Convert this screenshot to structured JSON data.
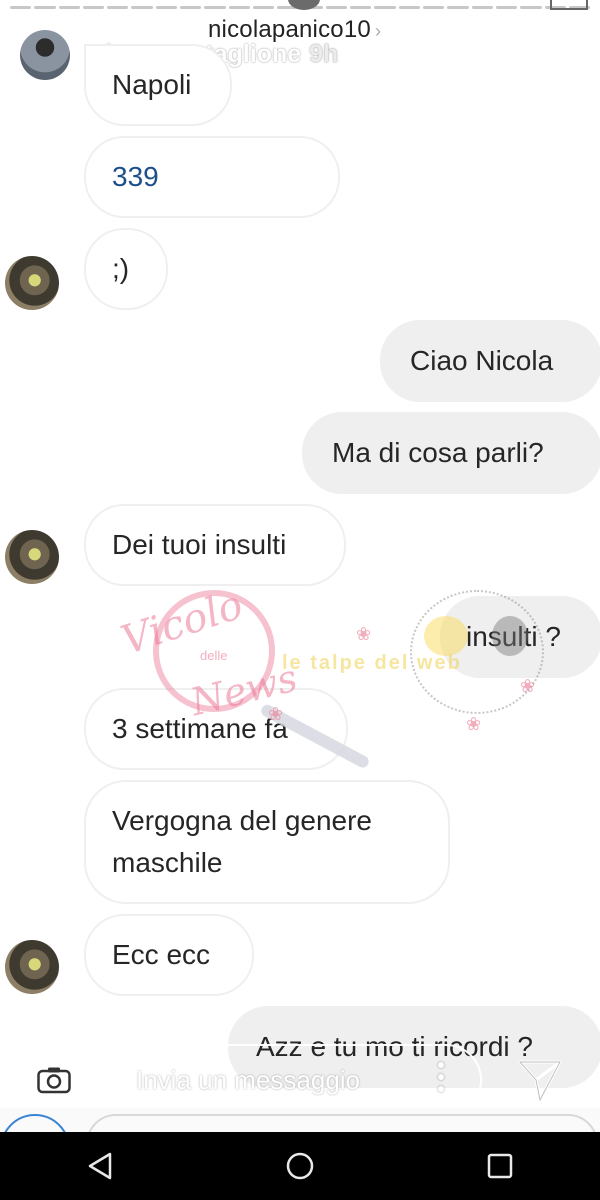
{
  "header": {
    "username": "nicolapanico10",
    "chevron": "›"
  },
  "poster": {
    "name": "pietro_tartaglione",
    "time": "9h"
  },
  "messages": [
    {
      "side": "left",
      "text": "Napoli"
    },
    {
      "side": "left",
      "text": "339"
    },
    {
      "side": "left",
      "text": ";)"
    },
    {
      "side": "right",
      "text": "Ciao Nicola"
    },
    {
      "side": "right",
      "text": "Ma di cosa parli?"
    },
    {
      "side": "left",
      "text": "Dei tuoi insulti"
    },
    {
      "side": "right",
      "text": "insulti ?"
    },
    {
      "side": "left",
      "text": "3 settimane fa"
    },
    {
      "side": "left",
      "text": "Vergogna del genere\nmaschile"
    },
    {
      "side": "left",
      "text": "Ecc ecc"
    },
    {
      "side": "right",
      "text": "Azz e tu mo ti ricordi ?"
    }
  ],
  "watermark": {
    "script_top": "Vicolo",
    "small": "delle",
    "script_bottom": "News",
    "right_text": "le talpe del web"
  },
  "reply": {
    "placeholder": "Invia un messaggio"
  },
  "icons": {
    "camera": "camera-icon",
    "more": "more-vertical-icon",
    "send": "send-icon",
    "back": "nav-back-icon",
    "home": "nav-home-icon",
    "recents": "nav-recents-icon"
  }
}
